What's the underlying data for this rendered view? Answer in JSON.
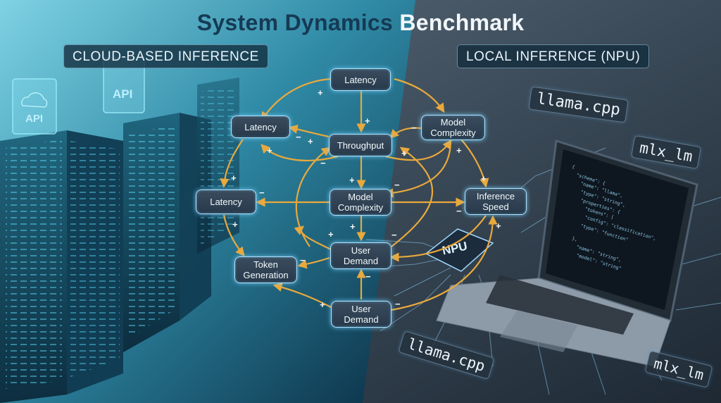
{
  "title": {
    "part1": "System Dynamics ",
    "part2": "Benchmark"
  },
  "panels": {
    "left": "CLOUD-BASED INFERENCE",
    "right": "LOCAL INFERENCE (NPU)"
  },
  "nodes": {
    "latency_top": "Latency",
    "latency_left": "Latency",
    "model_complexity_right": "Model\nComplexity",
    "throughput": "Throughput",
    "latency_mid": "Latency",
    "model_complexity_center": "Model\nComplexity",
    "inference_speed": "Inference\nSpeed",
    "token_generation": "Token\nGeneration",
    "user_demand_upper": "User\nDemand",
    "user_demand_lower": "User\nDemand"
  },
  "polarity": {
    "plus": "+",
    "minus": "−"
  },
  "tags": {
    "llama_top": "llama.cpp",
    "mlx_top": "mlx_lm",
    "llama_bottom": "llama.cpp",
    "mlx_bottom": "mlx_lm",
    "npu_chip": "NPU",
    "api_left": "API",
    "api_right": "API"
  },
  "colors": {
    "arrow": "#e9a93c",
    "node_border": "#aee3ff"
  }
}
